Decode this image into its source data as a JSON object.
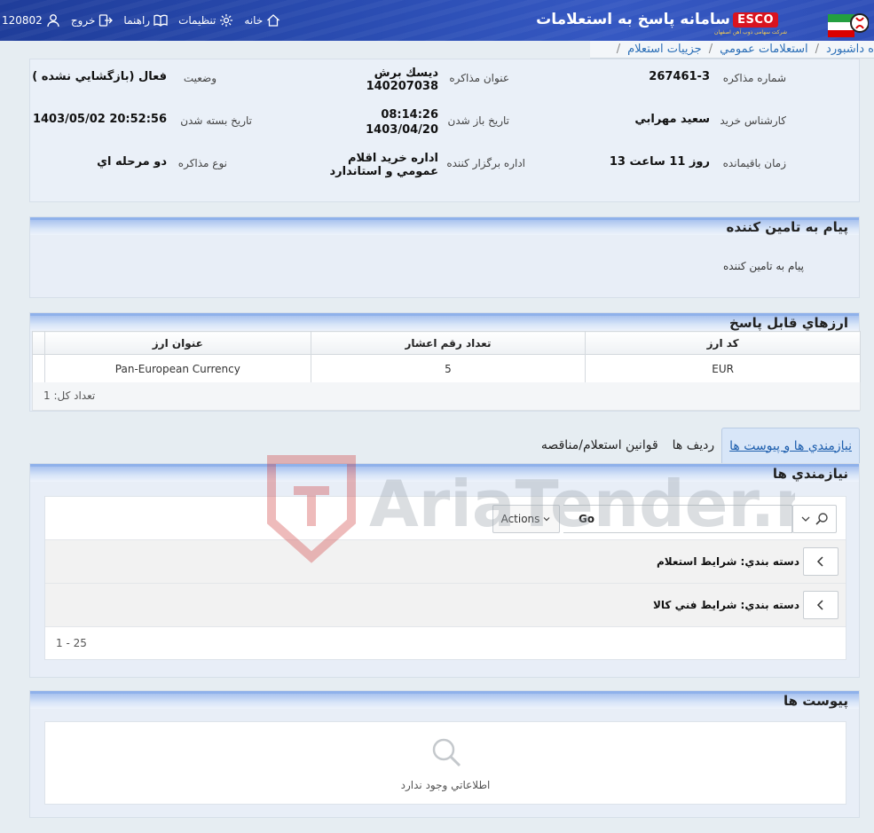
{
  "header": {
    "user_id": "120802",
    "logout": "خروج",
    "help": "راهنما",
    "settings": "تنظيمات",
    "home": "خانه",
    "title": "سامانه پاسخ به استعلامات",
    "brand": "ESCO",
    "brand_sub": "شرکت سهامی ذوب آهن اصفهان",
    "brand_color": "#d9141f"
  },
  "breadcrumb": [
    "ه داشبورد",
    "استعلامات عمومي",
    "جزييات استعلام"
  ],
  "info": {
    "number_label": "شماره مذاکره",
    "number_value": "267461-3",
    "subject_label": "عنوان مذاکره",
    "subject_value": "ديسك برش 140207038",
    "status_label": "وضعيت",
    "status_value": "فعال (بازگشايي نشده )",
    "expert_label": "کارشناس خريد",
    "expert_value": "سعيد مهرابي",
    "open_label": "تاريخ باز شدن",
    "open_time": "08:14:26",
    "open_date": "1403/04/20",
    "close_label": "تاريخ بسته شدن",
    "close_value": "1403/05/02 20:52:56",
    "remaining_label": "زمان باقيمانده",
    "remaining_value": "13 روز 11 ساعت",
    "office_label": "اداره برگزار کننده",
    "office_value": "اداره خريد اقلام عمومي و استاندارد",
    "type_label": "نوع مذاکره",
    "type_value": "دو مرحله اي"
  },
  "message": {
    "title": "پيام به تامين کننده",
    "body": "پيام به تامين کننده"
  },
  "currencies": {
    "title": "ارزهاي قابل پاسخ",
    "headers": [
      "کد ارز",
      "تعداد رقم اعشار",
      "عنوان ارز"
    ],
    "rows": [
      {
        "code": "EUR",
        "decimals": "5",
        "name": "Pan-European Currency"
      }
    ],
    "total": "تعداد کل: 1"
  },
  "tabs": [
    "نيازمندي ها و پيوست ها",
    "رديف ها",
    "قوانين استعلام/مناقصه"
  ],
  "requirements": {
    "title": "نيازمندي ها",
    "go_label": "Go",
    "actions_label": "Actions",
    "groups": [
      "دسته بندي: شرايط استعلام",
      "دسته بندي: شرايط فني کالا"
    ],
    "pagination": "1 - 25"
  },
  "attachments": {
    "title": "پيوست ها",
    "empty": "اطلاعاتي وجود ندارد"
  },
  "watermark": "AriaTender.neT"
}
